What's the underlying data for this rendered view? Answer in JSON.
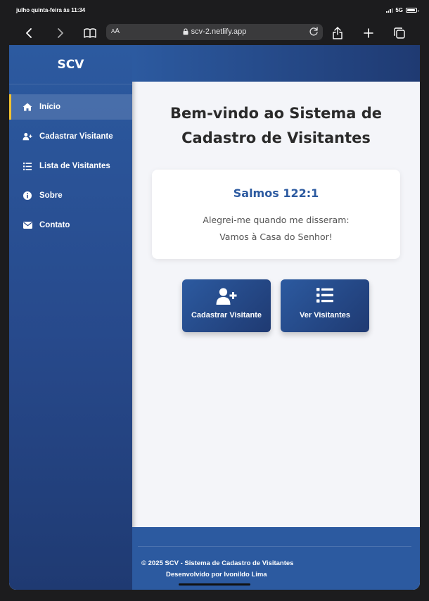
{
  "status_bar": {
    "time": "julho quinta-feira às 11:34",
    "network": "5G",
    "battery_level": 0.95
  },
  "browser": {
    "text_size_label_small": "A",
    "text_size_label_large": "A",
    "url": "scv-2.netlify.app",
    "icons": [
      "back-icon",
      "forward-icon",
      "bookmarks-icon",
      "lock-icon",
      "reload-icon",
      "share-icon",
      "new-tab-icon",
      "tabs-icon"
    ]
  },
  "sidebar": {
    "brand": "SCV",
    "items": [
      {
        "label": "Início",
        "icon": "home-icon",
        "active": true
      },
      {
        "label": "Cadastrar Visitante",
        "icon": "user-plus-icon",
        "active": false
      },
      {
        "label": "Lista de Visitantes",
        "icon": "list-icon",
        "active": false
      },
      {
        "label": "Sobre",
        "icon": "info-icon",
        "active": false
      },
      {
        "label": "Contato",
        "icon": "envelope-icon",
        "active": false
      }
    ],
    "active_accent": "#f2c230"
  },
  "main": {
    "title_line1": "Bem-vindo ao Sistema de",
    "title_line2": "Cadastro de Visitantes",
    "verse": {
      "reference": "Salmos 122:1",
      "line1": "Alegrei-me quando me disseram:",
      "line2": "Vamos à Casa do Senhor!"
    },
    "actions": [
      {
        "label": "Cadastrar Visitante",
        "icon": "user-plus-icon"
      },
      {
        "label": "Ver Visitantes",
        "icon": "list-icon"
      }
    ]
  },
  "footer": {
    "copyright": "© 2025 SCV - Sistema de Cadastro de Visitantes",
    "developer": "Desenvolvido por Ivonildo Lima"
  },
  "colors": {
    "primary": "#2c5aa0",
    "primary_dark": "#1f3a72",
    "background": "#f4f5f9"
  }
}
